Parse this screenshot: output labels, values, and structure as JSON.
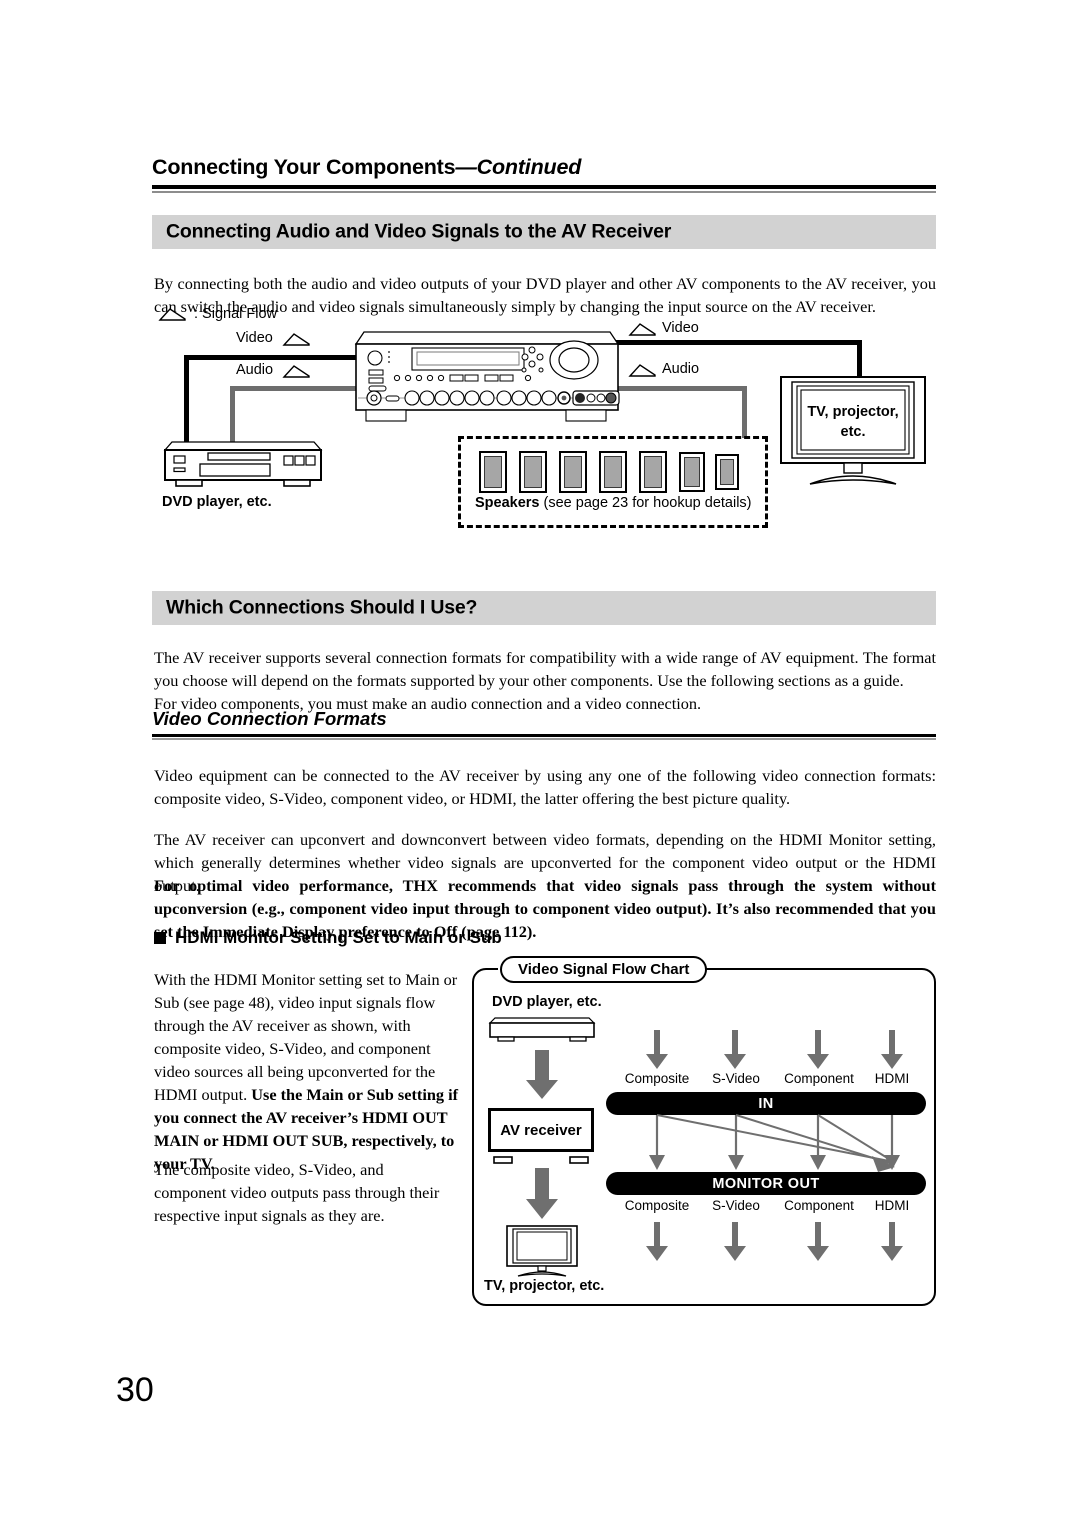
{
  "page": {
    "number": "30",
    "running_head_main": "Connecting Your Components",
    "running_head_cont": "—Continued"
  },
  "sections": [
    {
      "bar_title": "Connecting Audio and Video Signals to the AV Receiver",
      "paragraphs": [
        "By connecting both the audio and video outputs of your DVD player and other AV components to the AV receiver, you can switch the audio and video signals simultaneously simply by changing the input source on the AV receiver."
      ]
    },
    {
      "bar_title": "Which Connections Should I Use?",
      "paragraphs": [
        "The AV receiver supports several connection formats for compatibility with a wide range of AV equipment. The format you choose will depend on the formats supported by your other components. Use the following sections as a guide.",
        "For video components, you must make an audio connection and a video connection."
      ]
    }
  ],
  "subhead": "Video Connection Formats",
  "body": {
    "p1": "Video equipment can be connected to the AV receiver by using any one of the following video connection formats: composite video, S-Video, component video, or HDMI, the latter offering the best picture quality.",
    "p2": "The AV receiver can upconvert and downconvert between video formats, depending on the HDMI Monitor setting, which generally determines whether video signals are upconverted for the component video output or the HDMI output.",
    "p3_bold": "For optimal video performance, THX recommends that video signals pass through the system without upconversion (e.g., component video input through to component video output). It’s also recommended that you set the Immediate Display preference to Off (page 112)."
  },
  "bullet_heading": "HDMI Monitor Setting Set to Main or Sub",
  "column_text": {
    "p1_plain_a": "With the HDMI Monitor setting set to Main or Sub (see page 48), video input signals flow through the AV receiver as shown, with composite video, S-Video, and component video sources all being upconverted for the HDMI output. ",
    "p1_bold": "Use the Main or Sub setting if you connect the AV receiver’s HDMI OUT MAIN or HDMI OUT SUB, respectively, to your TV.",
    "p2": "The composite video, S-Video, and component video outputs pass through their respective input signals as they are."
  },
  "top_diagram": {
    "legend": ": Signal Flow",
    "in_video": "Video",
    "in_audio": "Audio",
    "out_video": "Video",
    "out_audio": "Audio",
    "dvd_label": "DVD player, etc.",
    "tv_label_line1": "TV, projector,",
    "tv_label_line2": "etc.",
    "speakers_bold": "Speakers",
    "speakers_rest": " (see page 23 for hookup details)",
    "speaker_count": 7
  },
  "chart_data": {
    "type": "diagram",
    "title": "Video Signal Flow Chart",
    "nodes": {
      "source": "DVD player, etc.",
      "device": "AV receiver",
      "sink": "TV, projector, etc."
    },
    "in_bar_label": "IN",
    "out_bar_label": "MONITOR OUT",
    "in_ports": [
      "Composite",
      "S-Video",
      "Component",
      "HDMI"
    ],
    "out_ports": [
      "Composite",
      "S-Video",
      "Component",
      "HDMI"
    ],
    "edges": [
      {
        "from": "Composite",
        "to": "Composite",
        "kind": "pass-through"
      },
      {
        "from": "S-Video",
        "to": "S-Video",
        "kind": "pass-through"
      },
      {
        "from": "Component",
        "to": "Component",
        "kind": "pass-through"
      },
      {
        "from": "HDMI",
        "to": "HDMI",
        "kind": "pass-through"
      },
      {
        "from": "Composite",
        "to": "HDMI",
        "kind": "upconvert"
      },
      {
        "from": "S-Video",
        "to": "HDMI",
        "kind": "upconvert"
      },
      {
        "from": "Component",
        "to": "HDMI",
        "kind": "upconvert"
      }
    ],
    "colors": {
      "bar": "#000000",
      "arrow": "#6f6f6f",
      "line": "#6f6f6f"
    }
  }
}
